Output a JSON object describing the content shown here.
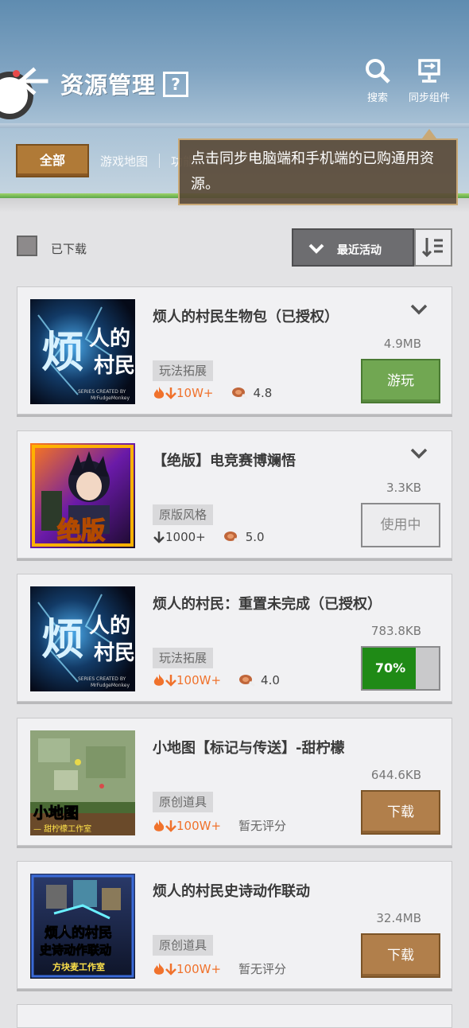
{
  "header": {
    "title": "资源管理",
    "help_glyph": "?",
    "search_label": "搜索",
    "sync_label": "同步组件"
  },
  "tabs": [
    "全部",
    "游戏地图",
    "功能"
  ],
  "tooltip": "点击同步电脑端和手机端的已购通用资源。",
  "filter": {
    "downloaded_label": "已下载",
    "downloaded_checked": false,
    "sort_label": "最近活动"
  },
  "items": [
    {
      "title": "烦人的村民生物包（已授权）",
      "size": "4.9MB",
      "tag": "玩法拓展",
      "downloads": "10W+",
      "hot": true,
      "rating": "4.8",
      "action": "游玩",
      "state": "play"
    },
    {
      "title": "【绝版】电竞赛博斓悟",
      "size": "3.3KB",
      "tag": "原版风格",
      "downloads": "1000+",
      "hot": false,
      "rating": "5.0",
      "action": "使用中",
      "state": "inuse"
    },
    {
      "title": "烦人的村民：重置未完成（已授权）",
      "size": "783.8KB",
      "tag": "玩法拓展",
      "downloads": "100W+",
      "hot": true,
      "rating": "4.0",
      "action": "70%",
      "state": "progress",
      "progress": 0.7
    },
    {
      "title": "小地图【标记与传送】-甜柠檬",
      "size": "644.6KB",
      "tag": "原创道具",
      "downloads": "100W+",
      "hot": true,
      "rating": "暂无评分",
      "action": "下载",
      "state": "download"
    },
    {
      "title": "烦人的村民史诗动作联动",
      "size": "32.4MB",
      "tag": "原创道具",
      "downloads": "100W+",
      "hot": true,
      "rating": "暂无评分",
      "action": "下载",
      "state": "download"
    }
  ],
  "thumb_text": {
    "villager_big": "烦",
    "villager_small_1": "人的",
    "villager_small_2": "村民",
    "villager_credit_1": "SERIES CREATED BY",
    "villager_credit_2": "MrFudgeMonkey",
    "exclusive": "绝版",
    "minimap": "小地图",
    "minimap_studio": "— 甜柠檬工作室",
    "epic_1": "烦人的村民",
    "epic_2": "史诗动作联动",
    "epic_3": "方块麦工作室"
  },
  "colors": {
    "accent_brown": "#b17f4b",
    "play_green": "#71a752",
    "progress_green": "#1f8a16",
    "hot_orange": "#f0722c"
  }
}
